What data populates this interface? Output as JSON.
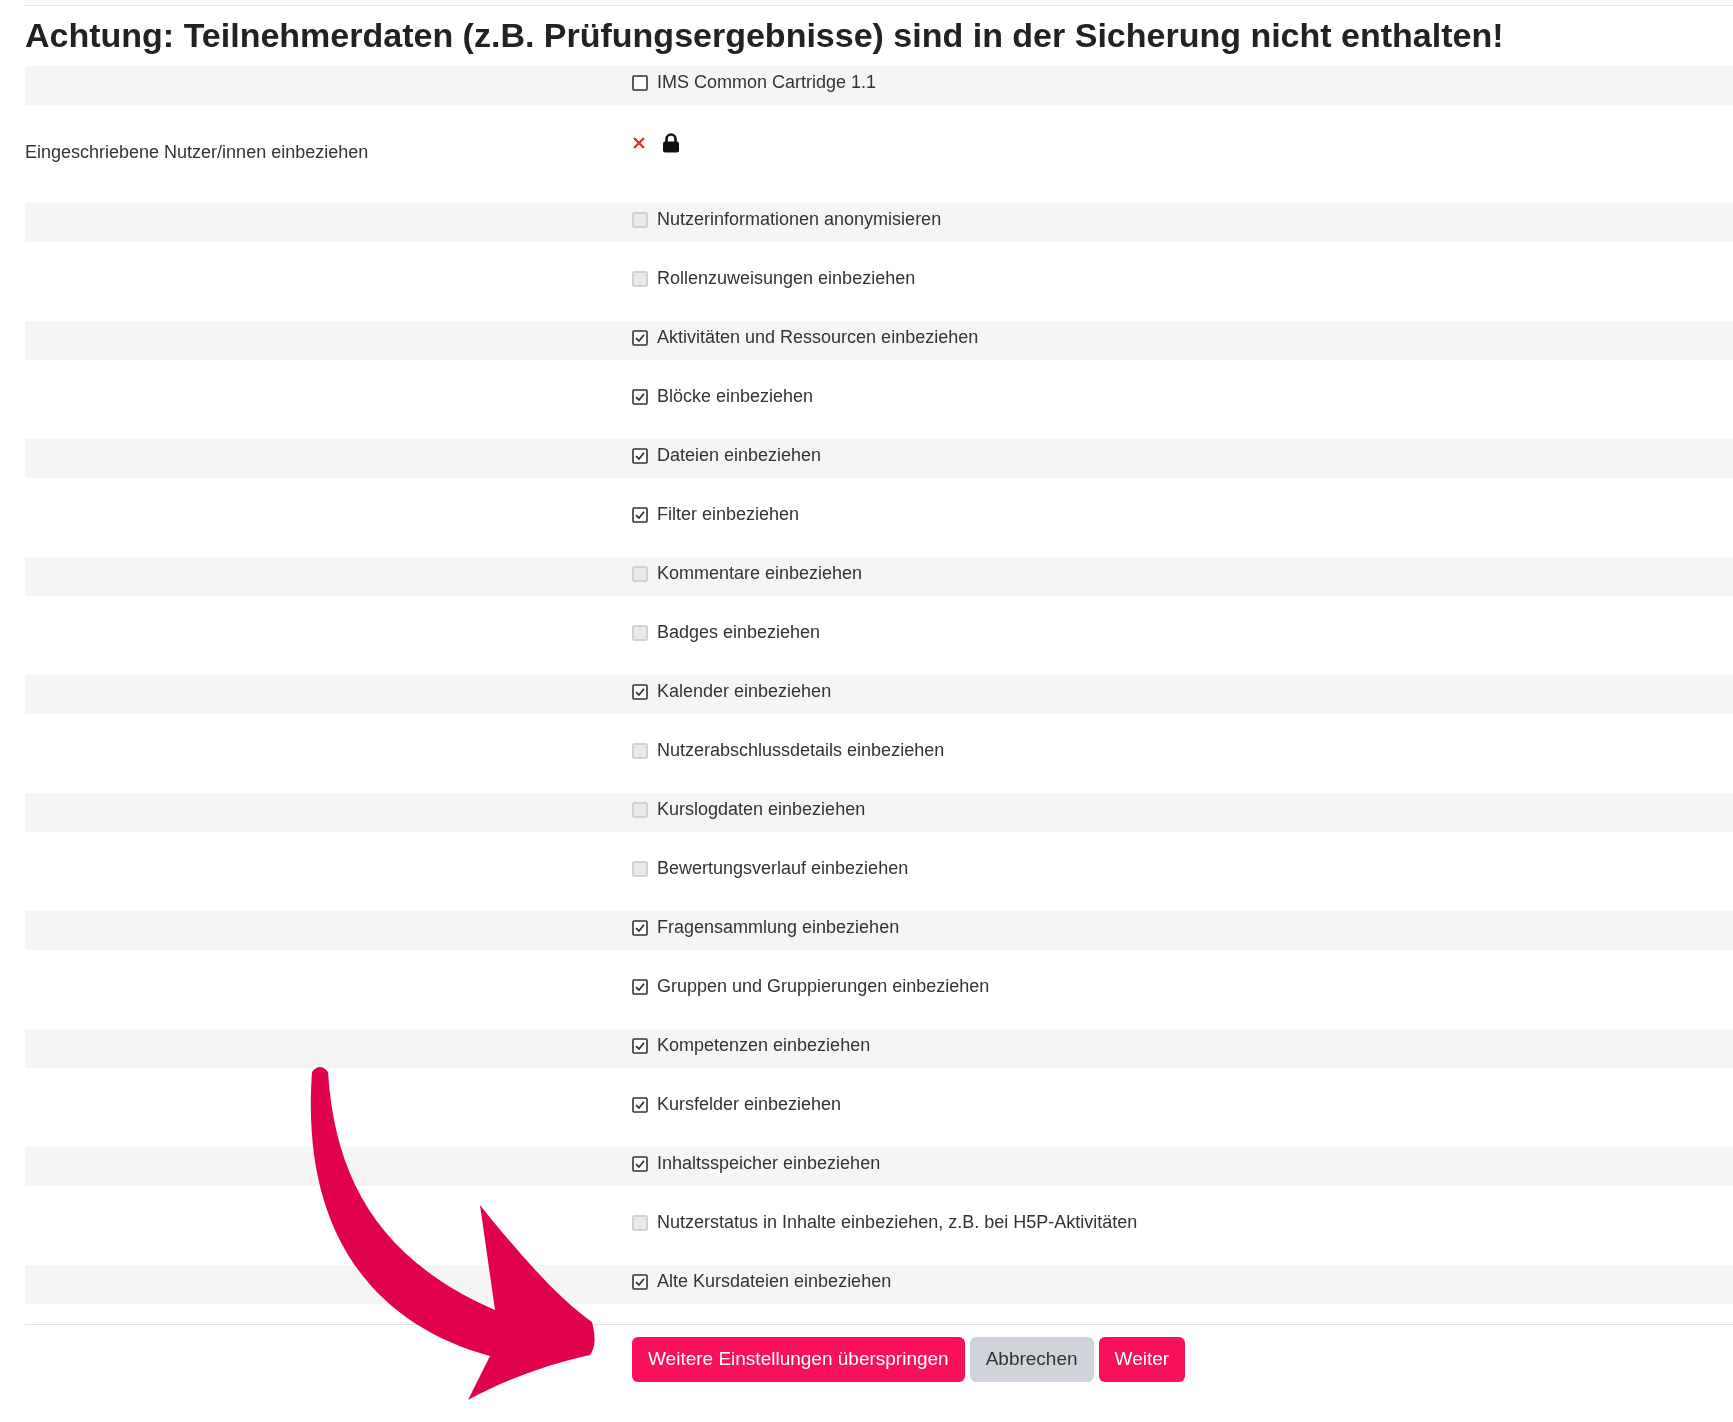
{
  "heading": "Achtung: Teilnehmerdaten (z.B. Prüfungsergebnisse) sind in der Sicherung nicht enthalten!",
  "settings": [
    {
      "kind": "checkbox",
      "label": "IMS Common Cartridge 1.1",
      "checked": false,
      "disabled": false
    },
    {
      "kind": "status",
      "name": "Eingeschriebene Nutzer/innen einbeziehen",
      "enabled": false,
      "locked": true
    },
    {
      "kind": "checkbox",
      "label": "Nutzerinformationen anonymisieren",
      "checked": false,
      "disabled": true
    },
    {
      "kind": "checkbox",
      "label": "Rollenzuweisungen einbeziehen",
      "checked": false,
      "disabled": true
    },
    {
      "kind": "checkbox",
      "label": "Aktivitäten und Ressourcen einbeziehen",
      "checked": true,
      "disabled": false
    },
    {
      "kind": "checkbox",
      "label": "Blöcke einbeziehen",
      "checked": true,
      "disabled": false
    },
    {
      "kind": "checkbox",
      "label": "Dateien einbeziehen",
      "checked": true,
      "disabled": false
    },
    {
      "kind": "checkbox",
      "label": "Filter einbeziehen",
      "checked": true,
      "disabled": false
    },
    {
      "kind": "checkbox",
      "label": "Kommentare einbeziehen",
      "checked": false,
      "disabled": true
    },
    {
      "kind": "checkbox",
      "label": "Badges einbeziehen",
      "checked": false,
      "disabled": true
    },
    {
      "kind": "checkbox",
      "label": "Kalender einbeziehen",
      "checked": true,
      "disabled": false
    },
    {
      "kind": "checkbox",
      "label": "Nutzerabschlussdetails einbeziehen",
      "checked": false,
      "disabled": true
    },
    {
      "kind": "checkbox",
      "label": "Kurslogdaten einbeziehen",
      "checked": false,
      "disabled": true
    },
    {
      "kind": "checkbox",
      "label": "Bewertungsverlauf einbeziehen",
      "checked": false,
      "disabled": true
    },
    {
      "kind": "checkbox",
      "label": "Fragensammlung einbeziehen",
      "checked": true,
      "disabled": false
    },
    {
      "kind": "checkbox",
      "label": "Gruppen und Gruppierungen einbeziehen",
      "checked": true,
      "disabled": false
    },
    {
      "kind": "checkbox",
      "label": "Kompetenzen einbeziehen",
      "checked": true,
      "disabled": false
    },
    {
      "kind": "checkbox",
      "label": "Kursfelder einbeziehen",
      "checked": true,
      "disabled": false
    },
    {
      "kind": "checkbox",
      "label": "Inhaltsspeicher einbeziehen",
      "checked": true,
      "disabled": false
    },
    {
      "kind": "checkbox",
      "label": "Nutzerstatus in Inhalte einbeziehen, z.B. bei H5P-Aktivitäten",
      "checked": false,
      "disabled": true
    },
    {
      "kind": "checkbox",
      "label": "Alte Kursdateien einbeziehen",
      "checked": true,
      "disabled": false
    }
  ],
  "buttons": [
    {
      "label": "Weitere Einstellungen überspringen",
      "kind": "primary"
    },
    {
      "label": "Abbrechen",
      "kind": "secondary"
    },
    {
      "label": "Weiter",
      "kind": "primary"
    }
  ]
}
